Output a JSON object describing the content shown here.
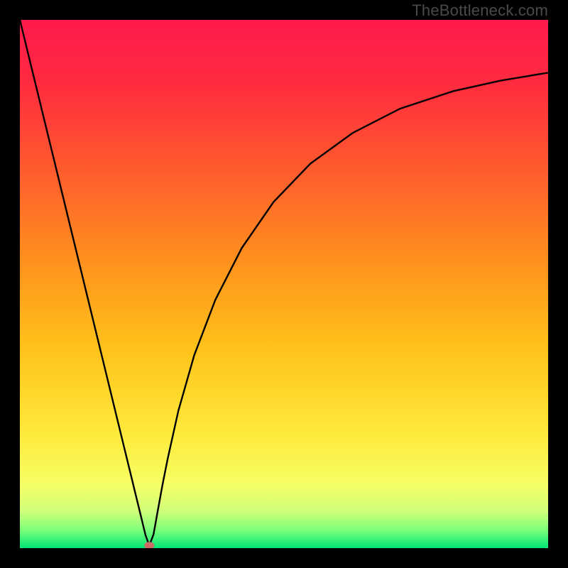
{
  "watermark": "TheBottleneck.com",
  "chart_data": {
    "type": "line",
    "title": "",
    "xlabel": "",
    "ylabel": "",
    "xlim": [
      0,
      100
    ],
    "ylim": [
      0,
      100
    ],
    "grid": false,
    "legend": false,
    "background_gradient": {
      "stops": [
        {
          "offset": 0.0,
          "color": "#ff1a4d"
        },
        {
          "offset": 0.12,
          "color": "#ff2b3f"
        },
        {
          "offset": 0.28,
          "color": "#ff5a2e"
        },
        {
          "offset": 0.45,
          "color": "#ff8f1e"
        },
        {
          "offset": 0.62,
          "color": "#ffc21a"
        },
        {
          "offset": 0.78,
          "color": "#ffe93a"
        },
        {
          "offset": 0.88,
          "color": "#f6ff66"
        },
        {
          "offset": 0.93,
          "color": "#d0ff7a"
        },
        {
          "offset": 0.965,
          "color": "#7fff7a"
        },
        {
          "offset": 1.0,
          "color": "#00e676"
        }
      ]
    },
    "series": [
      {
        "name": "bottleneck-curve",
        "color": "#000000",
        "x": [
          0.0,
          2.0,
          4.0,
          6.0,
          8.0,
          10.0,
          12.0,
          14.0,
          16.0,
          18.0,
          20.0,
          21.0,
          22.0,
          23.0,
          23.8,
          24.5,
          25.3,
          26.0,
          27.0,
          28.0,
          30.0,
          33.0,
          37.0,
          42.0,
          48.0,
          55.0,
          63.0,
          72.0,
          82.0,
          91.0,
          100.0
        ],
        "y": [
          100.0,
          91.8,
          83.6,
          75.4,
          67.2,
          59.0,
          50.8,
          42.6,
          34.4,
          26.2,
          18.0,
          13.9,
          9.8,
          5.7,
          2.4,
          0.5,
          2.6,
          6.5,
          12.0,
          17.0,
          26.0,
          36.5,
          47.0,
          56.8,
          65.5,
          72.8,
          78.6,
          83.2,
          86.5,
          88.5,
          90.0
        ]
      }
    ],
    "marker": {
      "name": "optimal-point",
      "x": 24.5,
      "y": 0.5,
      "color": "#cc6a66",
      "rx": 7,
      "ry": 5
    }
  }
}
